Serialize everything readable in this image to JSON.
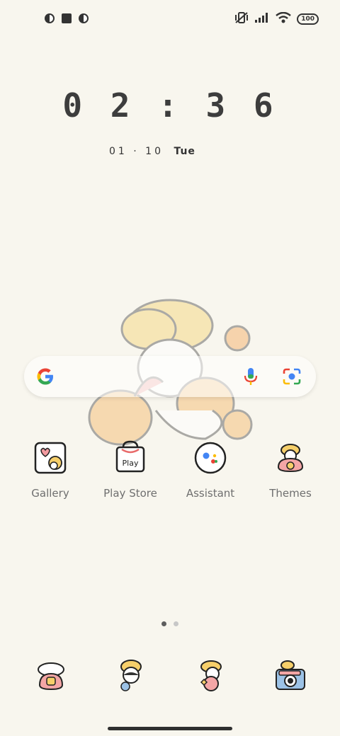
{
  "status_bar": {
    "left_icons": [
      "notification-icon-1",
      "notification-square-icon",
      "notification-icon-2"
    ],
    "right_icons": [
      "vibrate-off-icon",
      "signal-icon",
      "wifi-icon"
    ],
    "battery": "100"
  },
  "clock": {
    "time": "0 2 : 3 6"
  },
  "date": {
    "day_month": "01 · 10",
    "weekday": "Tue"
  },
  "search": {
    "logo": "google-g-icon",
    "mic": "mic-icon",
    "lens": "lens-icon"
  },
  "apps": [
    {
      "label": "Gallery",
      "icon": "gallery-icon"
    },
    {
      "label": "Play Store",
      "icon": "play-store-icon"
    },
    {
      "label": "Assistant",
      "icon": "assistant-icon"
    },
    {
      "label": "Themes",
      "icon": "themes-icon"
    }
  ],
  "page_indicator": {
    "pages": 2,
    "active": 1
  },
  "dock": [
    {
      "icon": "phone-icon"
    },
    {
      "icon": "messages-icon"
    },
    {
      "icon": "browser-icon"
    },
    {
      "icon": "camera-icon"
    }
  ],
  "colors": {
    "background": "#f8f6ee",
    "accent": "#f5c96a"
  }
}
